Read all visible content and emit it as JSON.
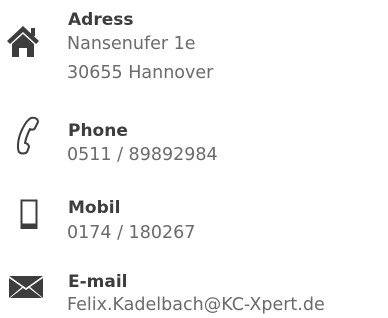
{
  "contact": {
    "address": {
      "icon": "home-icon",
      "label": "Adress",
      "line1": "Nansenufer 1e",
      "line2": "30655 Hannover"
    },
    "phone": {
      "icon": "telephone-handset-icon",
      "label": "Phone",
      "value": "0511 / 89892984"
    },
    "mobile": {
      "icon": "mobile-phone-icon",
      "label": "Mobil",
      "value": "0174 / 180267"
    },
    "email": {
      "icon": "envelope-icon",
      "label": "E-mail",
      "value": "Felix.Kadelbach@KC-Xpert.de"
    }
  },
  "colors": {
    "icon": "#3d3d3d",
    "label": "#3d3d3d",
    "value": "#6b6b6b",
    "background": "#ffffff"
  }
}
